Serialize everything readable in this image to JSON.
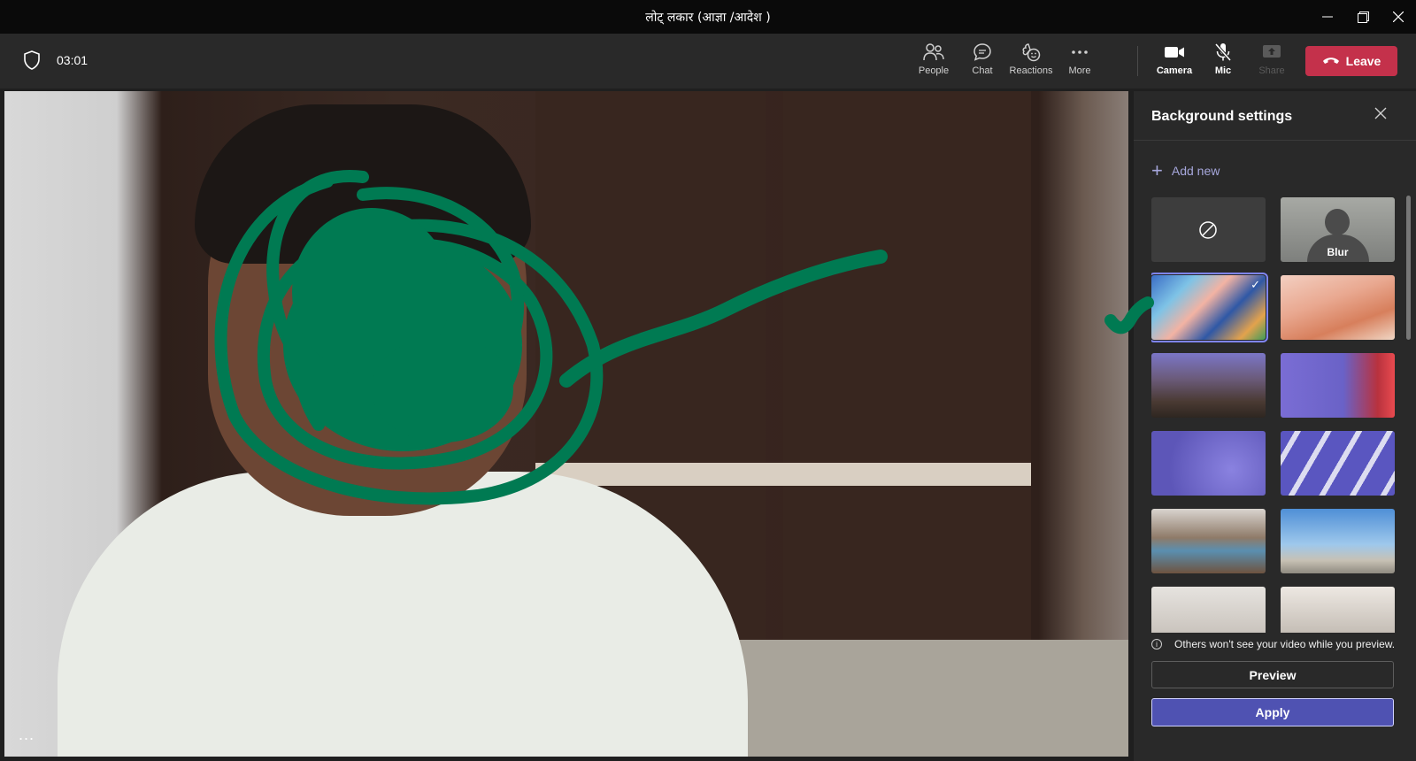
{
  "window": {
    "title": "लोट् लकार (आज्ञा /आदेश )"
  },
  "meeting": {
    "timer": "03:01",
    "more_options_label": "..."
  },
  "toolbar": {
    "people_label": "People",
    "chat_label": "Chat",
    "reactions_label": "Reactions",
    "more_label": "More",
    "camera_label": "Camera",
    "mic_label": "Mic",
    "share_label": "Share",
    "leave_label": "Leave"
  },
  "background_panel": {
    "title": "Background settings",
    "add_new_label": "Add new",
    "blur_label": "Blur",
    "notice": "Others won't see your video while you preview.",
    "preview_label": "Preview",
    "apply_label": "Apply",
    "selected_index": 2
  },
  "colors": {
    "leave": "#c4314b",
    "apply": "#4f52b2",
    "accent": "#7f85f5",
    "annotation": "#007a52"
  }
}
